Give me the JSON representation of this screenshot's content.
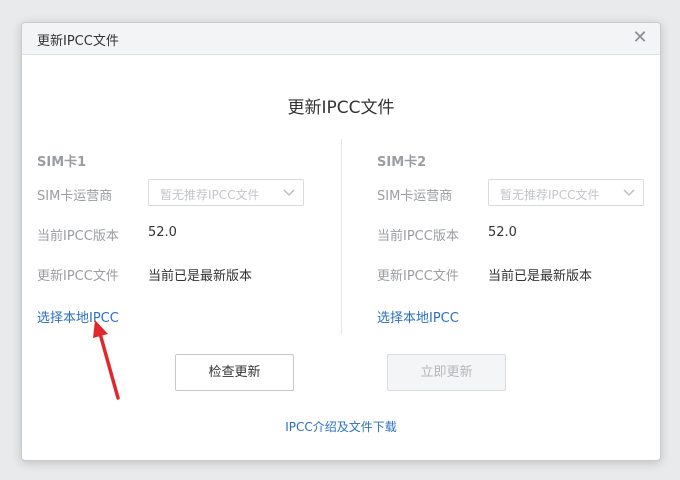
{
  "window": {
    "title": "更新IPCC文件",
    "close_glyph": "✕"
  },
  "heading": "更新IPCC文件",
  "sim1": {
    "title": "SIM卡1",
    "carrier_label": "SIM卡运营商",
    "carrier_placeholder": "暂无推荐IPCC文件",
    "version_label": "当前IPCC版本",
    "version_value": "52.0",
    "update_label": "更新IPCC文件",
    "update_value": "当前已是最新版本",
    "local_link": "选择本地IPCC"
  },
  "sim2": {
    "title": "SIM卡2",
    "carrier_label": "SIM卡运营商",
    "carrier_placeholder": "暂无推荐IPCC文件",
    "version_label": "当前IPCC版本",
    "version_value": "52.0",
    "update_label": "更新IPCC文件",
    "update_value": "当前已是最新版本",
    "local_link": "选择本地IPCC"
  },
  "buttons": {
    "check": "检查更新",
    "update_now": "立即更新"
  },
  "footer_link": "IPCC介绍及文件下载",
  "colors": {
    "link": "#2a6fc0",
    "annotation_arrow": "#e0282e"
  },
  "icons": {
    "close": "close-icon",
    "dropdown": "chevron-down-icon",
    "annotation": "red-arrow-annotation"
  }
}
